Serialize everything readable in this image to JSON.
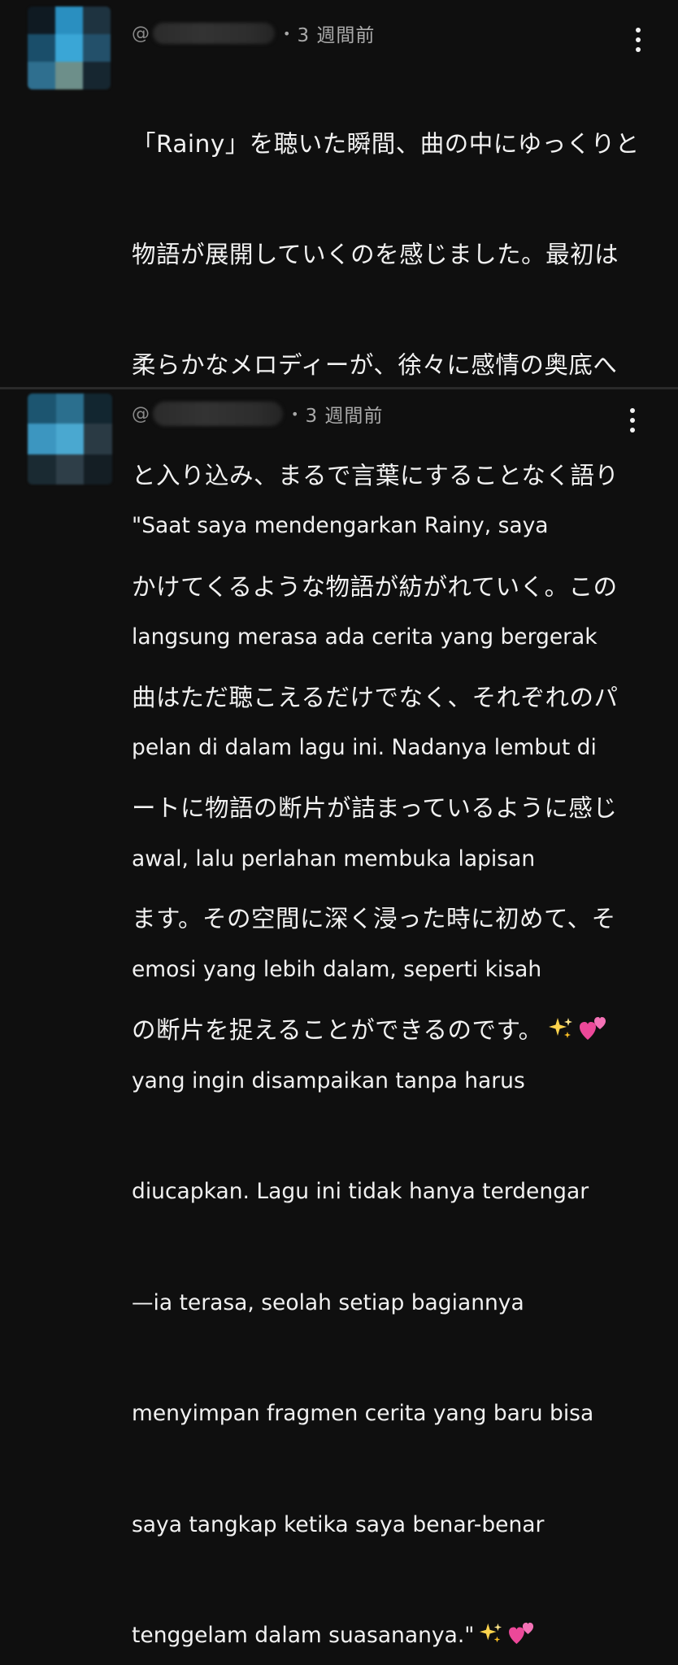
{
  "comments": [
    {
      "handle_prefix": "@",
      "separator": "•",
      "time": "3 週間前",
      "lines": [
        "「Rainy」を聴いた瞬間、曲の中にゆっくりと",
        "物語が展開していくのを感じました。最初は",
        "柔らかなメロディーが、徐々に感情の奥底へ",
        "と入り込み、まるで言葉にすることなく語り",
        "かけてくるような物語が紡がれていく。この",
        "曲はただ聴こえるだけでなく、それぞれのパ",
        "ートに物語の断片が詰まっているように感じ",
        "ます。その空間に深く浸った時に初めて、そ",
        "の断片を捉えることができるのです。"
      ],
      "emoji": [
        "sparkles-icon",
        "two-hearts-icon"
      ],
      "avatar_colors": [
        "#0f1a22",
        "#2a8fc0",
        "#1e3340",
        "#1a4e6a",
        "#3aa6d6",
        "#23506a",
        "#2f6f8f",
        "#6d8f8a",
        "#162630"
      ]
    },
    {
      "handle_prefix": "@",
      "separator": "•",
      "time": "3 週間前",
      "lines": [
        "\"Saat saya mendengarkan Rainy, saya",
        "langsung merasa ada cerita yang bergerak",
        "pelan di dalam lagu ini. Nadanya lembut di",
        "awal, lalu perlahan membuka lapisan",
        "emosi yang lebih dalam, seperti kisah",
        "yang ingin disampaikan tanpa harus",
        "diucapkan. Lagu ini tidak hanya terdengar",
        "—ia terasa, seolah setiap bagiannya",
        "menyimpan fragmen cerita yang baru bisa",
        "saya tangkap ketika saya benar-benar",
        "tenggelam dalam suasananya.\""
      ],
      "emoji": [
        "sparkles-icon",
        "two-hearts-icon"
      ],
      "avatar_colors": [
        "#1c5570",
        "#2b6f8e",
        "#122630",
        "#3c96c0",
        "#4aa8d0",
        "#2a3a44",
        "#1a2a32",
        "#2e3e48",
        "#141e24"
      ]
    }
  ],
  "colors": {
    "background": "#0f0f0f",
    "text": "#f1f1f1",
    "meta": "#aaaaaa",
    "divider": "#2a2a2a"
  }
}
